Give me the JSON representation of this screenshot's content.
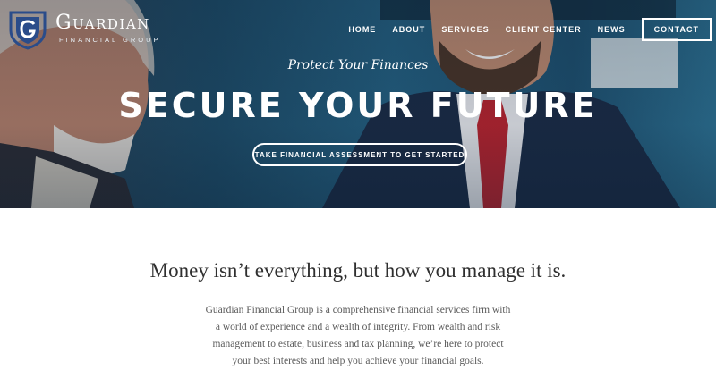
{
  "brand": {
    "name": "Guardian",
    "subtitle": "Financial Group",
    "logo_icon": "shield-g-icon"
  },
  "nav": {
    "items": [
      {
        "label": "HOME"
      },
      {
        "label": "ABOUT"
      },
      {
        "label": "SERVICES"
      },
      {
        "label": "CLIENT CENTER"
      },
      {
        "label": "NEWS"
      }
    ],
    "contact_label": "CONTACT"
  },
  "hero": {
    "tagline": "Protect Your Finances",
    "headline": "SECURE YOUR FUTURE",
    "cta_label": "TAKE FINANCIAL ASSESSMENT TO GET STARTED"
  },
  "intro": {
    "title": "Money isn’t everything, but how you manage it is.",
    "body": "Guardian Financial Group is a comprehensive financial services firm with a world of experience and a wealth of integrity. From wealth and risk management to estate, business and tax planning, we’re here to protect your best interests and help you achieve your financial goals."
  },
  "colors": {
    "hero_blue": "#1d4a66",
    "logo_blue": "#2a4c8a",
    "text_dark": "#2f2f2f",
    "text_body": "#5a5a5a"
  }
}
